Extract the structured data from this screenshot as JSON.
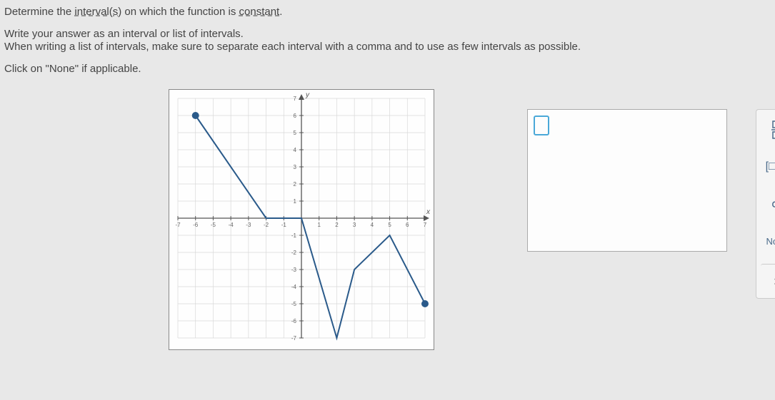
{
  "text": {
    "line1a": "Determine the ",
    "line1b": "interval(s)",
    "line1c": " on which the function is ",
    "line1d": "constant",
    "line1e": ".",
    "line2": "Write your answer as an interval or list of intervals.",
    "line3": "When writing a list of intervals, make sure to separate each interval with a comma and to use as few intervals as possible.",
    "line4": "Click on \"None\" if applicable."
  },
  "toolbox": {
    "interval_label": "[□,□]",
    "infinity_label": "∞",
    "none_label": "None",
    "clear_label": "×"
  },
  "chart_data": {
    "type": "line",
    "xlim": [
      -7,
      7
    ],
    "ylim": [
      -7,
      7
    ],
    "grid": true,
    "xlabel": "x",
    "ylabel": "y",
    "points": [
      {
        "x": -6,
        "y": 6
      },
      {
        "x": -2,
        "y": 0
      },
      {
        "x": 0,
        "y": 0
      },
      {
        "x": 2,
        "y": -7
      },
      {
        "x": 3,
        "y": -3
      },
      {
        "x": 5,
        "y": -1
      },
      {
        "x": 7,
        "y": -5
      }
    ],
    "endpoints": [
      {
        "x": -6,
        "y": 6,
        "filled": true
      },
      {
        "x": 7,
        "y": -5,
        "filled": true
      }
    ]
  }
}
